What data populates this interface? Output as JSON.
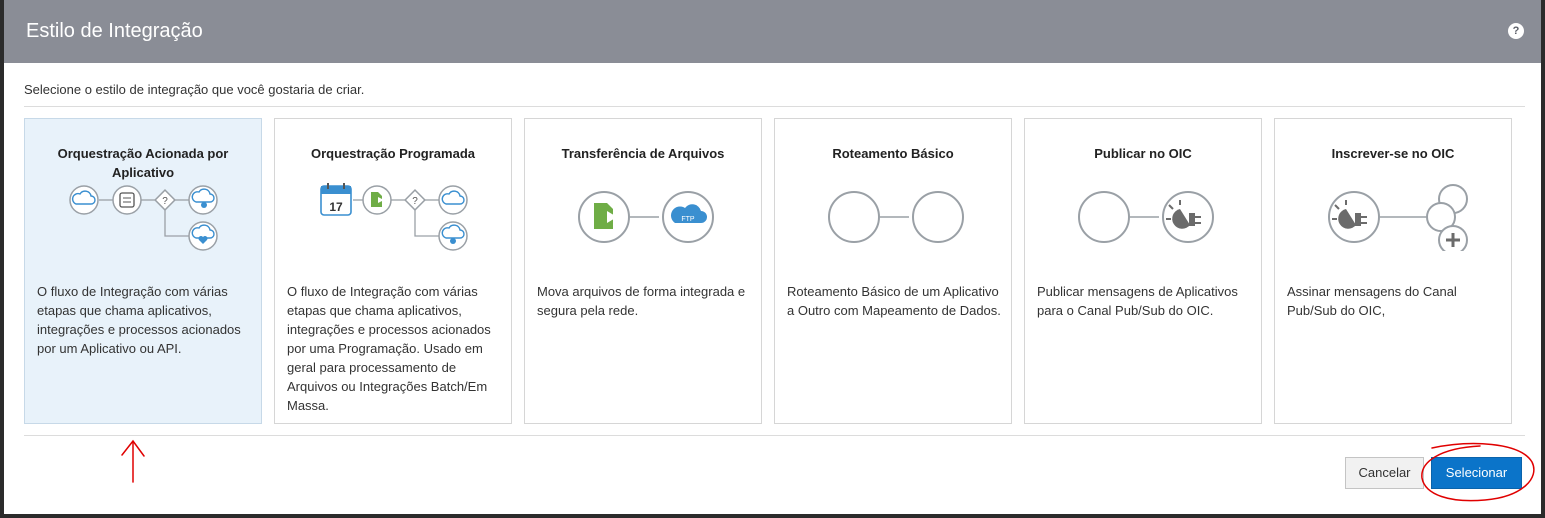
{
  "dialog": {
    "title": "Estilo de Integração",
    "help_label": "?",
    "instruction": "Selecione o estilo de integração que você gostaria de criar."
  },
  "cards": [
    {
      "title": "Orquestração Acionada por Aplicativo",
      "description": "O fluxo de Integração com várias etapas que chama aplicativos, integrações e processos acionados por um Aplicativo ou API.",
      "selected": true
    },
    {
      "title": "Orquestração Programada",
      "description": "O fluxo de Integração com várias etapas que chama aplicativos, integrações e processos acionados por uma Programação. Usado em geral para processamento de Arquivos ou Integrações Batch/Em Massa.",
      "calendar_day": "17"
    },
    {
      "title": "Transferência de Arquivos",
      "description": "Mova arquivos de forma integrada e segura pela rede.",
      "ftp_label": "FTP"
    },
    {
      "title": "Roteamento Básico",
      "description": "Roteamento Básico de um Aplicativo a Outro com Mapeamento de Dados."
    },
    {
      "title": "Publicar no OIC",
      "description": "Publicar mensagens de Aplicativos para o Canal Pub/Sub do OIC."
    },
    {
      "title": "Inscrever-se no OIC",
      "description": "Assinar mensagens do Canal Pub/Sub do OIC,"
    }
  ],
  "footer": {
    "cancel_label": "Cancelar",
    "select_label": "Selecionar"
  },
  "colors": {
    "header": "#8a8d96",
    "selected_card": "#e8f2fa",
    "primary_button": "#0b74c9",
    "icon_blue": "#3a8fd0",
    "icon_green": "#6fad46",
    "annotation_red": "#e00000"
  }
}
